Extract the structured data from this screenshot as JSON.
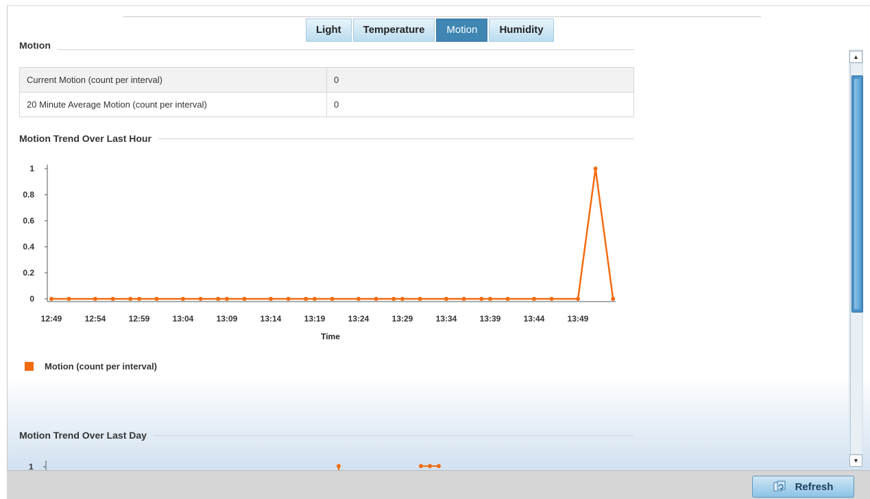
{
  "tabs": [
    {
      "label": "Light",
      "active": false
    },
    {
      "label": "Temperature",
      "active": false
    },
    {
      "label": "Motion",
      "active": true
    },
    {
      "label": "Humidity",
      "active": false
    }
  ],
  "motion_section": {
    "title": "Motion",
    "rows": [
      {
        "label": "Current Motion (count per interval)",
        "value": "0"
      },
      {
        "label": "20 Minute Average Motion (count per interval)",
        "value": "0"
      }
    ]
  },
  "hour_chart": {
    "title": "Motion Trend Over Last Hour",
    "legend_label": "Motion (count per interval)"
  },
  "day_chart": {
    "title": "Motion Trend Over Last Day",
    "first_tick": "1"
  },
  "footer": {
    "refresh_label": "Refresh"
  },
  "colors": {
    "series": "#f26b0f",
    "active_tab": "#3f86b3"
  },
  "chart_data": [
    {
      "type": "line",
      "title": "Motion Trend Over Last Hour",
      "xlabel": "Time",
      "ylabel": "",
      "ylim": [
        0,
        1
      ],
      "yticks": [
        "0",
        "0.2",
        "0.4",
        "0.6",
        "0.8",
        "1"
      ],
      "xticks": [
        "12:49",
        "12:54",
        "12:59",
        "13:04",
        "13:09",
        "13:14",
        "13:19",
        "13:24",
        "13:29",
        "13:34",
        "13:39",
        "13:44",
        "13:49"
      ],
      "series": [
        {
          "name": "Motion (count per interval)",
          "color": "#f26b0f",
          "x": [
            "12:49",
            "12:51",
            "12:54",
            "12:56",
            "12:58",
            "12:59",
            "13:01",
            "13:04",
            "13:06",
            "13:08",
            "13:09",
            "13:11",
            "13:14",
            "13:16",
            "13:18",
            "13:19",
            "13:21",
            "13:24",
            "13:26",
            "13:28",
            "13:29",
            "13:31",
            "13:34",
            "13:36",
            "13:38",
            "13:39",
            "13:41",
            "13:44",
            "13:46",
            "13:49",
            "13:51",
            "13:53"
          ],
          "values": [
            0,
            0,
            0,
            0,
            0,
            0,
            0,
            0,
            0,
            0,
            0,
            0,
            0,
            0,
            0,
            0,
            0,
            0,
            0,
            0,
            0,
            0,
            0,
            0,
            0,
            0,
            0,
            0,
            0,
            0,
            1,
            0
          ]
        }
      ],
      "legend": "bottom-left"
    }
  ]
}
